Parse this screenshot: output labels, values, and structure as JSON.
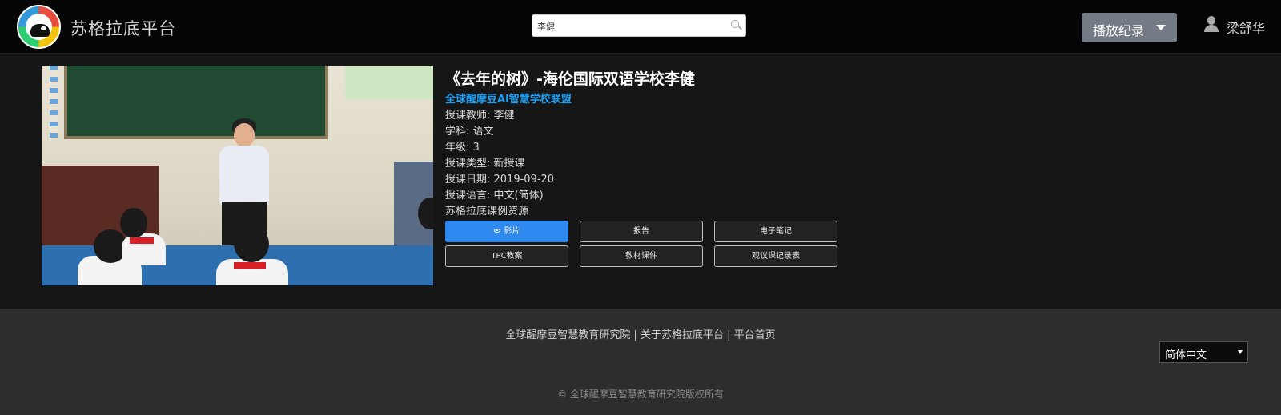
{
  "header": {
    "brand": "苏格拉底平台",
    "search_value": "李健",
    "play_record_label": "播放纪录",
    "username": "梁舒华"
  },
  "lesson": {
    "title": "《去年的树》-海伦国际双语学校李健",
    "org": "全球醒摩豆AI智慧学校联盟",
    "teacher": "授课教师: 李健",
    "subject": "学科: 语文",
    "grade": "年级: 3",
    "type": "授课类型: 新授课",
    "date": "授课日期: 2019-09-20",
    "language": "授课语言: 中文(简体)",
    "resource": "苏格拉底课例资源"
  },
  "actions": {
    "video": "影片",
    "report": "报告",
    "notes": "电子笔记",
    "tpc": "TPC教案",
    "materials": "教材课件",
    "observation": "观议课记录表"
  },
  "footer": {
    "links": "全球醒摩豆智慧教育研究院 | 关于苏格拉底平台 | 平台首页",
    "language_selected": "简体中文",
    "copyright": "© 全球醒摩豆智慧教育研究院版权所有"
  },
  "icons": {
    "logo": "logo-icon",
    "search": "search-icon",
    "caret": "caret-down-icon",
    "user": "user-icon",
    "eye": "eye-icon"
  },
  "colors": {
    "primary_button": "#2f89ef",
    "org_link": "#1e9ef0",
    "play_button": "#757b85"
  }
}
